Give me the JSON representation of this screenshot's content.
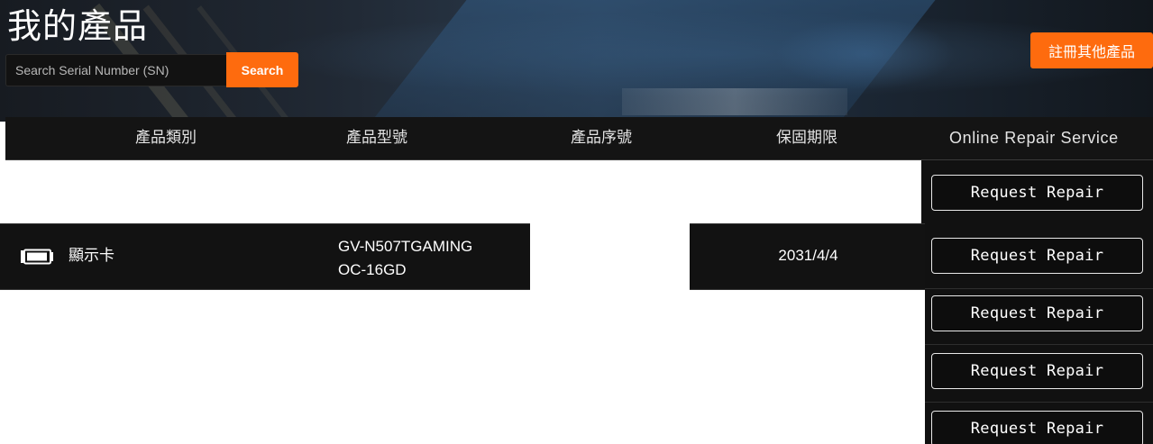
{
  "header": {
    "title": "我的產品",
    "search": {
      "placeholder": "Search Serial Number (SN)",
      "value": "",
      "button_label": "Search"
    },
    "register_button_label": "註冊其他產品"
  },
  "table": {
    "columns": [
      "產品類別",
      "產品型號",
      "產品序號",
      "保固期限",
      "Online Repair Service"
    ],
    "rows": [
      {
        "icon": "graphics-card-icon",
        "category": "顯示卡",
        "model_line1": "GV-N507TGAMING",
        "model_line2": "OC-16GD",
        "serial": "",
        "warranty": "2031/4/4"
      }
    ],
    "repair_buttons": [
      "Request Repair",
      "Request Repair",
      "Request Repair",
      "Request Repair",
      "Request Repair"
    ]
  },
  "colors": {
    "accent": "#fe6b0e",
    "header_bg": "#141414",
    "row_bg": "#121212",
    "text": "#ffffff"
  }
}
